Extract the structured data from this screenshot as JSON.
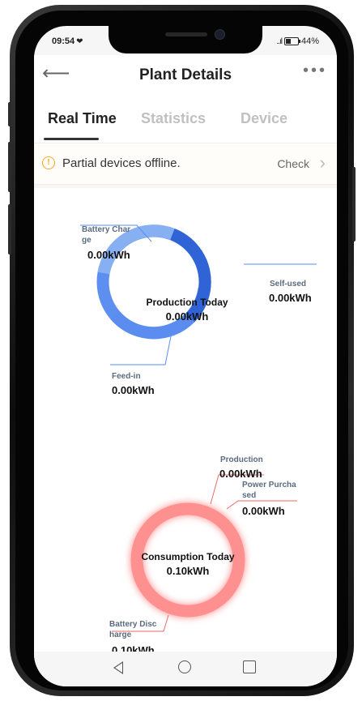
{
  "status": {
    "time": "09:54",
    "signal": "..ıl",
    "battery": "44%",
    "battery_level": 0.44
  },
  "header": {
    "title": "Plant Details"
  },
  "tabs": [
    {
      "label": "Real Time",
      "active": true
    },
    {
      "label": "Statistics",
      "active": false
    },
    {
      "label": "Device",
      "active": false
    }
  ],
  "notice": {
    "text": "Partial devices offline.",
    "action": "Check"
  },
  "production": {
    "center_title": "Production Today",
    "center_value": "0.00kWh",
    "battery_charge": {
      "label_line1": "Battery Char",
      "label_line2": "ge",
      "value": "0.00kWh"
    },
    "self_used": {
      "label": "Self-used",
      "value": "0.00kWh"
    },
    "feed_in": {
      "label": "Feed-in",
      "value": "0.00kWh"
    }
  },
  "consumption": {
    "center_title": "Consumption Today",
    "center_value": "0.10kWh",
    "production": {
      "label": "Production",
      "value": "0.00kWh"
    },
    "power_purchased": {
      "label_line1": "Power Purcha",
      "label_line2": "sed",
      "value": "0.00kWh"
    },
    "battery_discharge": {
      "label_line1": "Battery Disc",
      "label_line2": "harge",
      "value": "0.10kWh"
    }
  },
  "colors": {
    "production_ring_light": "#86b0f2",
    "production_ring_dark": "#2f63d6",
    "consumption_ring": "#ff8a8a",
    "warning": "#f5a623"
  }
}
